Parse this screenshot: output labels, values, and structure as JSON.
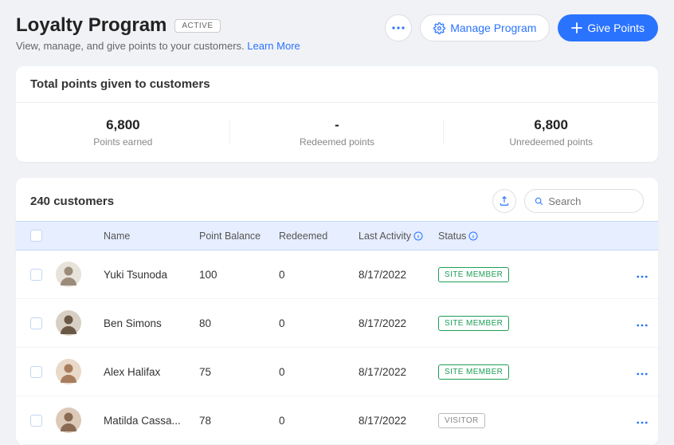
{
  "header": {
    "title": "Loyalty Program",
    "badge": "ACTIVE",
    "subtitle": "View, manage, and give points to your customers.",
    "learn_more": "Learn More",
    "manage_btn": "Manage Program",
    "give_btn": "Give Points"
  },
  "stats_card": {
    "title": "Total points given to customers",
    "items": [
      {
        "value": "6,800",
        "label": "Points earned"
      },
      {
        "value": "-",
        "label": "Redeemed points"
      },
      {
        "value": "6,800",
        "label": "Unredeemed points"
      }
    ]
  },
  "table": {
    "count_label": "240 customers",
    "search_placeholder": "Search",
    "columns": {
      "name": "Name",
      "balance": "Point Balance",
      "redeemed": "Redeemed",
      "last_activity": "Last Activity",
      "status": "Status"
    },
    "rows": [
      {
        "name": "Yuki Tsunoda",
        "balance": "100",
        "redeemed": "0",
        "last_activity": "8/17/2022",
        "status": "SITE MEMBER",
        "status_type": "member",
        "avatar_bg": "#e8e3da",
        "avatar_fg": "#9b8c7a"
      },
      {
        "name": "Ben Simons",
        "balance": "80",
        "redeemed": "0",
        "last_activity": "8/17/2022",
        "status": "SITE MEMBER",
        "status_type": "member",
        "avatar_bg": "#d8cfc4",
        "avatar_fg": "#6b5844"
      },
      {
        "name": "Alex Halifax",
        "balance": "75",
        "redeemed": "0",
        "last_activity": "8/17/2022",
        "status": "SITE MEMBER",
        "status_type": "member",
        "avatar_bg": "#e9d9c8",
        "avatar_fg": "#a87d5e"
      },
      {
        "name": "Matilda Cassa...",
        "balance": "78",
        "redeemed": "0",
        "last_activity": "8/17/2022",
        "status": "VISITOR",
        "status_type": "visitor",
        "avatar_bg": "#dcc9b8",
        "avatar_fg": "#8a6a52"
      }
    ]
  }
}
